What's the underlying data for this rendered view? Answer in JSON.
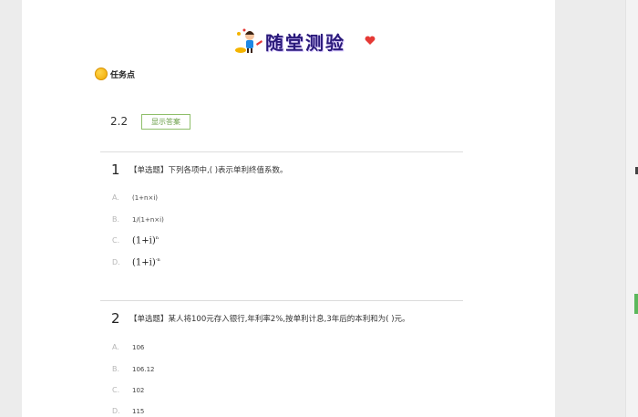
{
  "banner": {
    "title": "随堂测验"
  },
  "task": {
    "label": "任务点"
  },
  "section": {
    "number": "2.2",
    "show_answer_label": "显示答案"
  },
  "questions": [
    {
      "number": "1",
      "text": "【单选题】下列各项中,( )表示单利终值系数。",
      "options": [
        {
          "letter": "A.",
          "text": "(1+n×i)"
        },
        {
          "letter": "B.",
          "text": "1/(1+n×i)"
        },
        {
          "letter": "C.",
          "text": "(1+i)",
          "sup": "n"
        },
        {
          "letter": "D.",
          "text": "(1+i)",
          "sup": "-n"
        }
      ]
    },
    {
      "number": "2",
      "text": "【单选题】某人将100元存入银行,年利率2%,按单利计息,3年后的本利和为( )元。",
      "options": [
        {
          "letter": "A.",
          "text": "106"
        },
        {
          "letter": "B.",
          "text": "106.12"
        },
        {
          "letter": "C.",
          "text": "102"
        },
        {
          "letter": "D.",
          "text": "115"
        }
      ]
    }
  ],
  "colors": {
    "accent_green": "#6a9e47",
    "task_dot": "#f0a800"
  }
}
